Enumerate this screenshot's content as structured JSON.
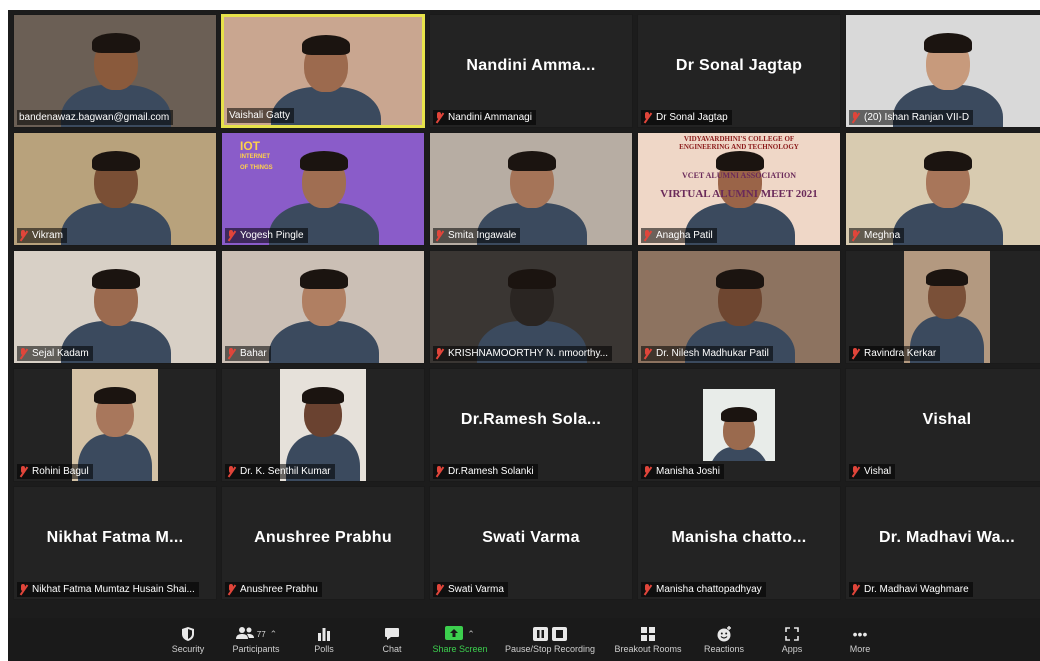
{
  "meeting": {
    "tiles": [
      {
        "name": "bandenawaz.bagwan@gmail.com",
        "muted": false,
        "video": true,
        "active": false,
        "bg": "#6b5f55",
        "skin": "#8a5a3c"
      },
      {
        "name": "Vaishali Gatty",
        "muted": false,
        "video": true,
        "active": true,
        "bg": "#c9a690",
        "skin": "#9c6a4e"
      },
      {
        "name": "Nandini Ammanagi",
        "muted": true,
        "video": false,
        "display": "Nandini  Amma...",
        "active": false
      },
      {
        "name": "Dr Sonal Jagtap",
        "muted": true,
        "video": false,
        "display": "Dr Sonal Jagtap",
        "active": false
      },
      {
        "name": "(20) Ishan Ranjan VII-D",
        "muted": true,
        "video": true,
        "active": false,
        "bg": "#d9d9d9",
        "skin": "#c79a7c"
      },
      {
        "name": "Vikram",
        "muted": true,
        "video": true,
        "active": false,
        "bg": "#b8a27c",
        "skin": "#7a4f35"
      },
      {
        "name": "Yogesh Pingle",
        "muted": true,
        "video": true,
        "active": false,
        "bg": "#8a5cc9",
        "skin": "#a06e52"
      },
      {
        "name": "Smita Ingawale",
        "muted": true,
        "video": true,
        "active": false,
        "bg": "#b7ada3",
        "skin": "#a57458"
      },
      {
        "name": "Anagha Patil",
        "muted": true,
        "video": true,
        "active": false,
        "bg": "#efd7c7",
        "skin": "#9a6448"
      },
      {
        "name": "Meghna",
        "muted": true,
        "video": true,
        "active": false,
        "bg": "#d8cbb0",
        "skin": "#a8765a"
      },
      {
        "name": "Sejal Kadam",
        "muted": true,
        "video": true,
        "active": false,
        "bg": "#d8d0c6",
        "skin": "#9b6a4f"
      },
      {
        "name": "Bahar",
        "muted": true,
        "video": true,
        "active": false,
        "bg": "#cbbfb5",
        "skin": "#b07f62"
      },
      {
        "name": "KRISHNAMOORTHY N. nmoorthy...",
        "muted": true,
        "video": true,
        "active": false,
        "bg": "#3a3633",
        "skin": "#2a2522"
      },
      {
        "name": "Dr. Nilesh Madhukar Patil",
        "muted": true,
        "video": true,
        "active": false,
        "bg": "#8d7360",
        "skin": "#6e4630"
      },
      {
        "name": "Ravindra Kerkar",
        "muted": true,
        "video": true,
        "active": false,
        "bg": "#b39980",
        "skin": "#7a5038",
        "narrow": true
      },
      {
        "name": "Rohini Bagul",
        "muted": true,
        "video": true,
        "active": false,
        "bg": "#d4c2a6",
        "skin": "#a8775c",
        "narrow": true
      },
      {
        "name": "Dr. K. Senthil Kumar",
        "muted": true,
        "video": true,
        "active": false,
        "bg": "#e6e1da",
        "skin": "#6a4230",
        "narrow": true
      },
      {
        "name": "Dr.Ramesh Solanki",
        "muted": true,
        "video": false,
        "display": "Dr.Ramesh  Sola...",
        "active": false
      },
      {
        "name": "Manisha Joshi",
        "muted": true,
        "video": true,
        "active": false,
        "bg": "#e8ece9",
        "skin": "#9a6a4e",
        "small": true
      },
      {
        "name": "Vishal",
        "muted": true,
        "video": false,
        "display": "Vishal",
        "active": false
      },
      {
        "name": "Nikhat Fatma Mumtaz Husain Shai...",
        "muted": true,
        "video": false,
        "display": "Nikhat Fatma  M...",
        "active": false
      },
      {
        "name": "Anushree Prabhu",
        "muted": true,
        "video": false,
        "display": "Anushree Prabhu",
        "active": false
      },
      {
        "name": "Swati Varma",
        "muted": true,
        "video": false,
        "display": "Swati Varma",
        "active": false
      },
      {
        "name": "Manisha chattopadhyay",
        "muted": true,
        "video": false,
        "display": "Manisha  chatto...",
        "active": false
      },
      {
        "name": "Dr. Madhavi Waghmare",
        "muted": true,
        "video": false,
        "display": "Dr.  Madhavi  Wa...",
        "active": false
      }
    ],
    "screen_share_content": {
      "tile7": {
        "line1": "IOT",
        "line2": "INTERNET",
        "line3": "OF THINGS"
      },
      "tile9": {
        "line1": "VIDYAVARDHINI'S COLLEGE OF",
        "line2": "ENGINEERING AND TECHNOLOGY",
        "line3": "VCET ALUMNI ASSOCIATION",
        "line4": "VIRTUAL ALUMNI MEET 2021"
      }
    }
  },
  "toolbar": {
    "items": [
      {
        "label": "Security",
        "icon": "shield-icon"
      },
      {
        "label": "Participants",
        "icon": "participants-icon",
        "count": "77"
      },
      {
        "label": "Polls",
        "icon": "polls-icon"
      },
      {
        "label": "Chat",
        "icon": "chat-icon"
      },
      {
        "label": "Share Screen",
        "icon": "share-screen-icon"
      },
      {
        "label": "Pause/Stop Recording",
        "icon": "recording-icon"
      },
      {
        "label": "Breakout Rooms",
        "icon": "breakout-rooms-icon"
      },
      {
        "label": "Reactions",
        "icon": "reactions-icon"
      },
      {
        "label": "Apps",
        "icon": "apps-icon"
      },
      {
        "label": "More",
        "icon": "more-icon"
      }
    ],
    "share_color": "#3ccf4e",
    "mute_color": "#e0453a",
    "active_speaker_color": "#e6e24a"
  }
}
